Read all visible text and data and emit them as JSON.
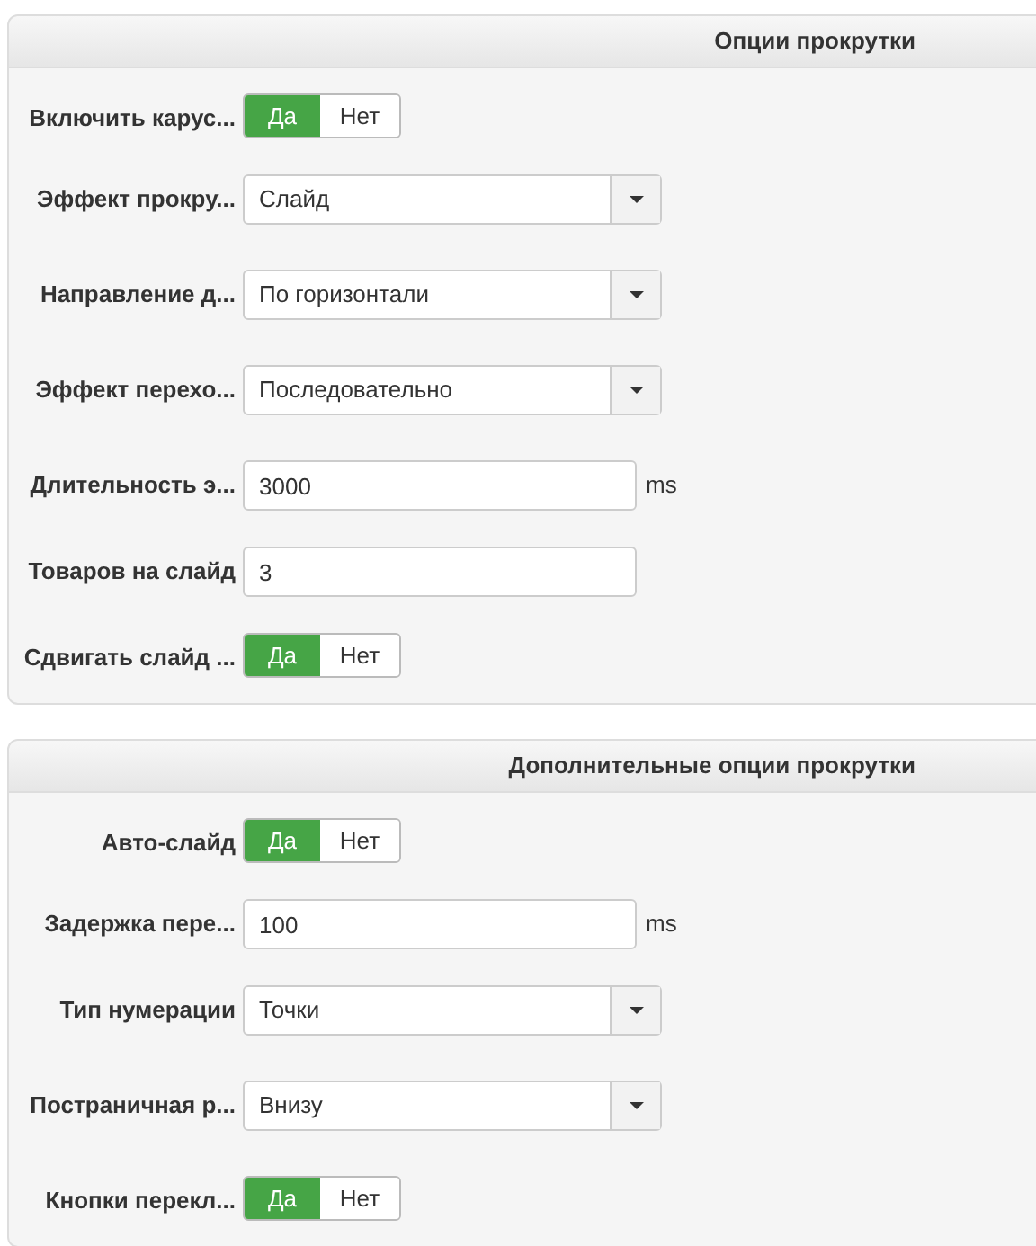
{
  "panels": [
    {
      "title": "Опции прокрутки",
      "fields": [
        {
          "kind": "toggle",
          "label": "Включить карус...",
          "options": [
            {
              "label": "Да",
              "selected": true
            },
            {
              "label": "Нет",
              "selected": false
            }
          ]
        },
        {
          "kind": "select",
          "label": "Эффект прокру...",
          "value": "Слайд"
        },
        {
          "kind": "select",
          "label": "Направление д...",
          "value": "По горизонтали"
        },
        {
          "kind": "select",
          "label": "Эффект перехо...",
          "value": "Последовательно"
        },
        {
          "kind": "input",
          "label": "Длительность э...",
          "value": "3000",
          "unit": "ms"
        },
        {
          "kind": "input",
          "label": "Товаров на слайд",
          "value": "3"
        },
        {
          "kind": "toggle",
          "label": "Сдвигать слайд ...",
          "options": [
            {
              "label": "Да",
              "selected": true
            },
            {
              "label": "Нет",
              "selected": false
            }
          ]
        }
      ]
    },
    {
      "title": "Дополнительные опции прокрутки",
      "fields": [
        {
          "kind": "toggle",
          "label": "Авто-слайд",
          "options": [
            {
              "label": "Да",
              "selected": true
            },
            {
              "label": "Нет",
              "selected": false
            }
          ]
        },
        {
          "kind": "input",
          "label": "Задержка пере...",
          "value": "100",
          "unit": "ms"
        },
        {
          "kind": "select",
          "label": "Тип нумерации",
          "value": "Точки"
        },
        {
          "kind": "select",
          "label": "Постраничная р...",
          "value": "Внизу"
        },
        {
          "kind": "toggle",
          "label": "Кнопки перекл...",
          "options": [
            {
              "label": "Да",
              "selected": true
            },
            {
              "label": "Нет",
              "selected": false
            }
          ]
        }
      ]
    }
  ]
}
